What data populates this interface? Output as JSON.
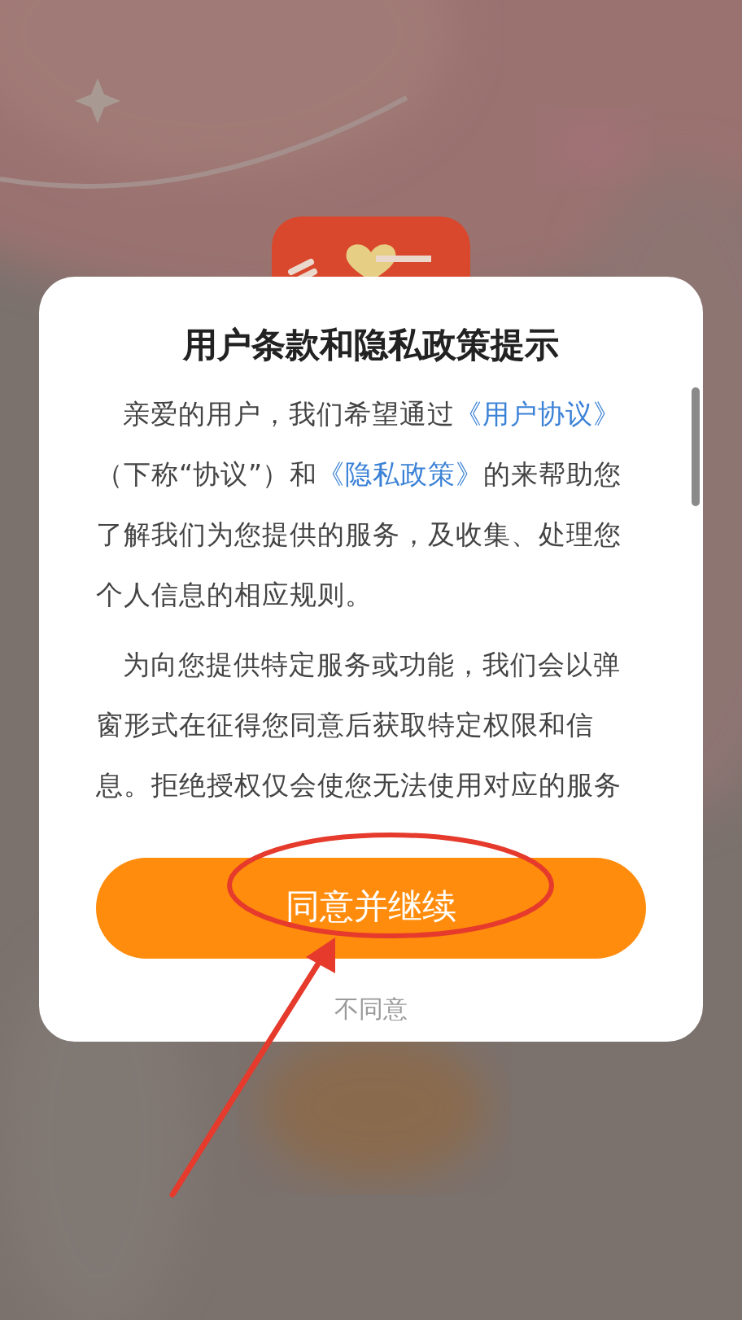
{
  "dialog": {
    "title": "用户条款和隐私政策提示",
    "paragraphs": [
      [
        {
          "kind": "text",
          "text": "亲爱的用户，我们希望通过"
        },
        {
          "kind": "link",
          "text": "《用户协议》"
        },
        {
          "kind": "text",
          "text": "（下称“协议”）和"
        },
        {
          "kind": "link",
          "text": "《隐私政策》"
        },
        {
          "kind": "text",
          "text": "的来帮助您了解我们为您提供的服务，及收集、处理您个人信息的相应规则。"
        }
      ],
      [
        {
          "kind": "text",
          "text": "为向您提供特定服务或功能，我们会以弹窗形式在征得您同意后获取特定权限和信息。拒绝授权仅会使您无法使用对应的服务"
        }
      ]
    ],
    "agree_button": "同意并继续",
    "disagree_link": "不同意"
  }
}
